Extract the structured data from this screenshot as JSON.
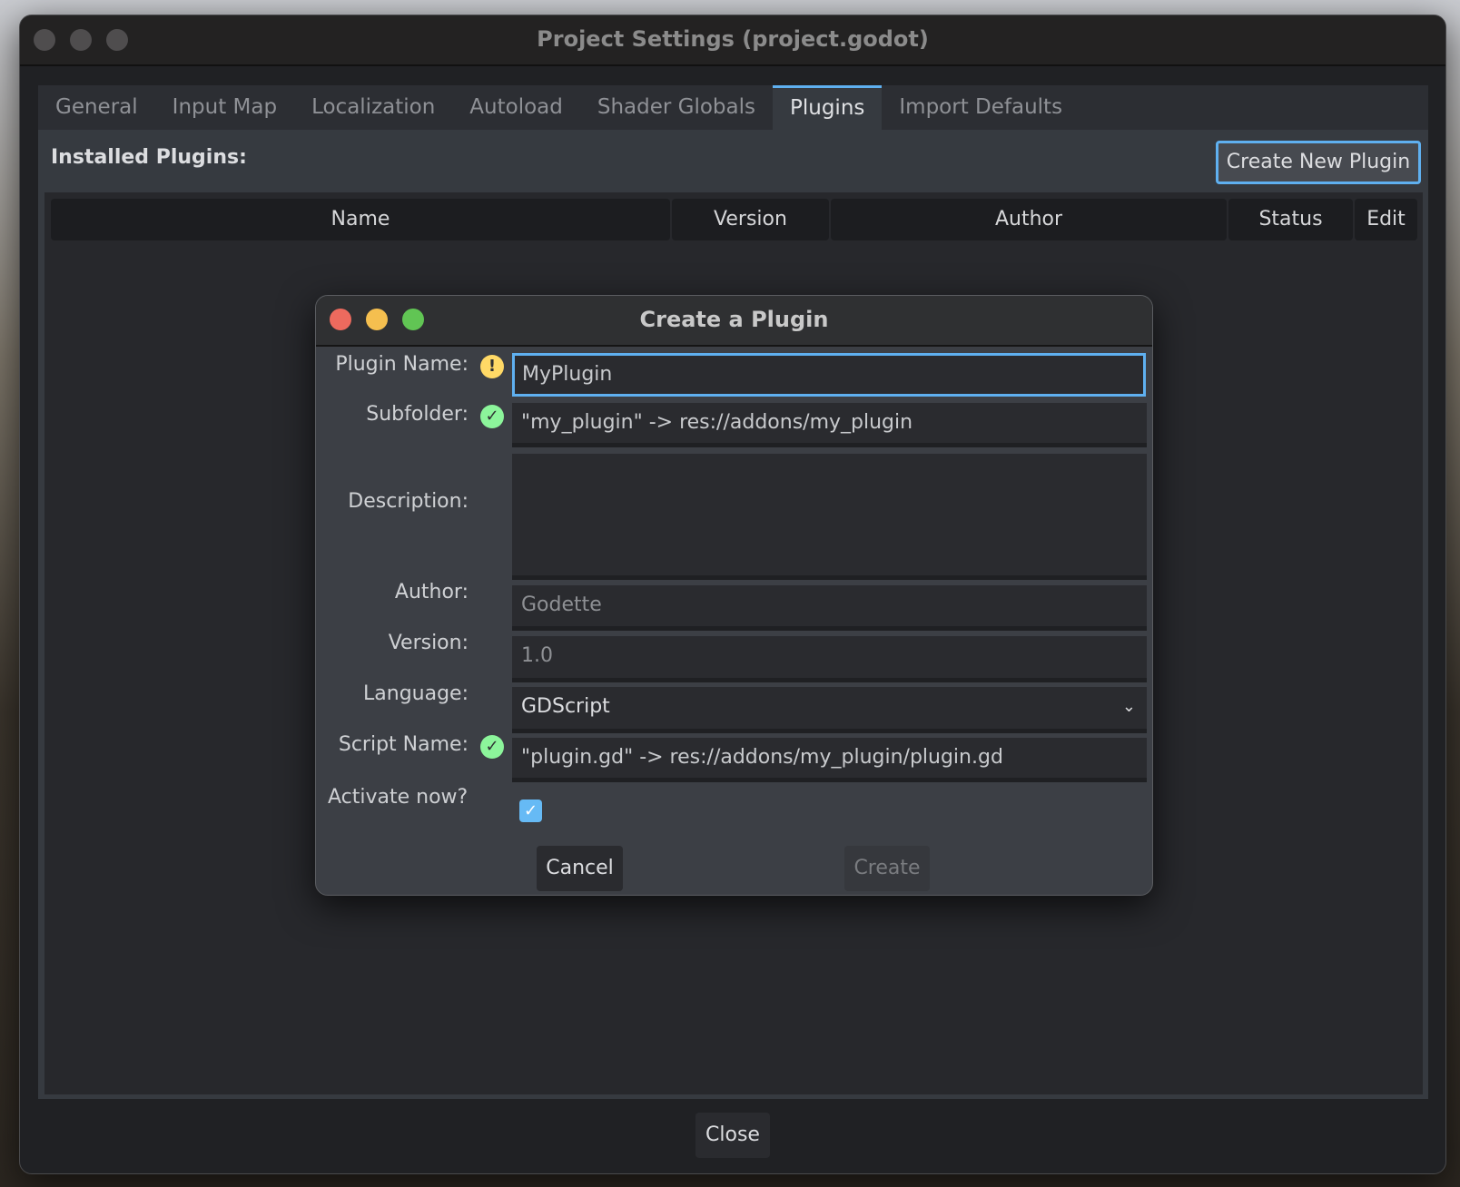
{
  "window": {
    "title": "Project Settings (project.godot)"
  },
  "tabs": [
    {
      "label": "General"
    },
    {
      "label": "Input Map"
    },
    {
      "label": "Localization"
    },
    {
      "label": "Autoload"
    },
    {
      "label": "Shader Globals"
    },
    {
      "label": "Plugins",
      "selected": true
    },
    {
      "label": "Import Defaults"
    }
  ],
  "plugins": {
    "heading": "Installed Plugins:",
    "create_button": "Create New Plugin",
    "columns": [
      "Name",
      "Version",
      "Author",
      "Status",
      "Edit"
    ]
  },
  "close_button": "Close",
  "dialog": {
    "title": "Create a Plugin",
    "plugin_name": {
      "label": "Plugin Name:",
      "value": "MyPlugin",
      "status": "warning"
    },
    "subfolder": {
      "label": "Subfolder:",
      "value": "\"my_plugin\" -> res://addons/my_plugin",
      "status": "ok"
    },
    "description": {
      "label": "Description:",
      "value": ""
    },
    "author": {
      "label": "Author:",
      "placeholder": "Godette"
    },
    "version": {
      "label": "Version:",
      "placeholder": "1.0"
    },
    "language": {
      "label": "Language:",
      "value": "GDScript"
    },
    "script_name": {
      "label": "Script Name:",
      "value": "\"plugin.gd\" -> res://addons/my_plugin/plugin.gd",
      "status": "ok"
    },
    "activate": {
      "label": "Activate now?",
      "checked": true
    },
    "cancel": "Cancel",
    "create": "Create"
  },
  "colors": {
    "accent": "#5fb0f0",
    "warning": "#ffd966",
    "ok": "#8cf59b"
  }
}
